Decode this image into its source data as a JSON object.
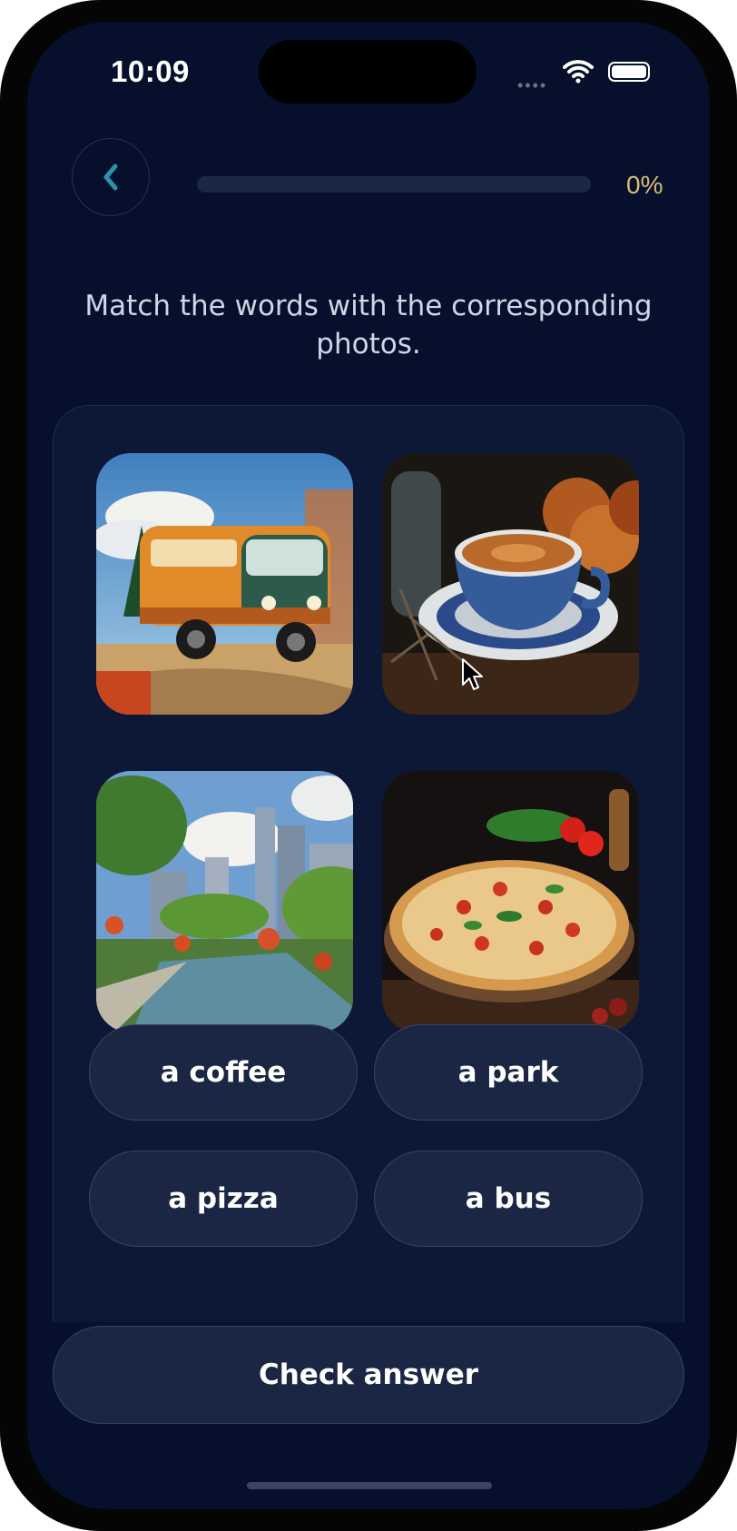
{
  "status_bar": {
    "time": "10:09"
  },
  "header": {
    "progress_label": "0%",
    "progress_value": 0
  },
  "instruction": "Match the words with the corresponding photos.",
  "images": [
    {
      "name": "bus-photo"
    },
    {
      "name": "coffee-photo"
    },
    {
      "name": "park-photo"
    },
    {
      "name": "pizza-photo"
    }
  ],
  "words": [
    "a coffee",
    "a park",
    "a pizza",
    "a bus"
  ],
  "footer": {
    "check_label": "Check answer"
  }
}
